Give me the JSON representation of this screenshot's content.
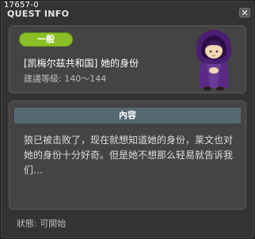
{
  "window": {
    "quest_id": "17657-0",
    "title": "QUEST INFO"
  },
  "quest": {
    "category_badge": "一般",
    "name": "[凯梅尔兹共和国] 她的身份",
    "level": "建議等級: 140～144",
    "npc_icon": "hooded-purple-girl"
  },
  "content": {
    "header": "內容",
    "body": "狼已被击败了，现在就想知道她的身份，莱文也对她的身份十分好奇。但是她不想那么轻易就告诉我们…"
  },
  "status": "狀態: 可開始",
  "colors": {
    "badge": "#8bbf28",
    "content_header": "#566873",
    "panel": "#444444",
    "window": "#333333"
  }
}
